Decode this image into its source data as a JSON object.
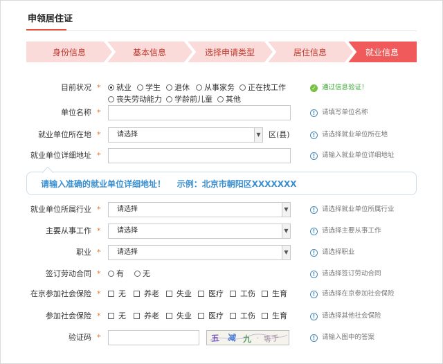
{
  "page_title": "申领居住证",
  "steps": [
    {
      "label": "身份信息",
      "active": false
    },
    {
      "label": "基本信息",
      "active": false
    },
    {
      "label": "选择申请类型",
      "active": false
    },
    {
      "label": "居住信息",
      "active": false
    },
    {
      "label": "就业信息",
      "active": true
    }
  ],
  "colors": {
    "accent": "#e84c3d",
    "step_bg": "#fbdada",
    "step_active": "#f05a5a",
    "tip_blue": "#3a8fd0"
  },
  "required_mark": "*",
  "status": {
    "label": "目前状况",
    "options": [
      "就业",
      "学生",
      "退休",
      "从事家务",
      "正在找工作",
      "丧失劳动能力",
      "学龄前儿童",
      "其他"
    ],
    "selected": "就业",
    "hint": "通过信息验证！"
  },
  "employer_name": {
    "label": "单位名称",
    "value": "",
    "hint": "请填写单位名称"
  },
  "employer_location": {
    "label": "就业单位所在地",
    "selected": "请选择",
    "suffix": "区(县)",
    "hint": "请选择就业单位所在地"
  },
  "employer_address": {
    "label": "就业单位详细地址",
    "value": "",
    "hint": "请输入就业单位详细地址"
  },
  "address_tip": "请输入准确的就业单位详细地址！    示例：北京市朝阳区XXXXXXX",
  "industry": {
    "label": "就业单位所属行业",
    "selected": "请选择",
    "hint": "请选择就业单位所属行业"
  },
  "main_work": {
    "label": "主要从事工作",
    "selected": "请选择",
    "hint": "请选择主要从事工作"
  },
  "occupation": {
    "label": "职业",
    "selected": "请选择",
    "hint": "请选择职业"
  },
  "contract": {
    "label": "签订劳动合同",
    "options": [
      "有",
      "无"
    ],
    "hint": "请选择签订劳动合同"
  },
  "beijing_insurance": {
    "label": "在京参加社会保险",
    "options": [
      "无",
      "养老",
      "失业",
      "医疗",
      "工伤",
      "生育"
    ],
    "hint": "请选择在京参加社会保险"
  },
  "other_insurance": {
    "label": "参加社会保险",
    "options": [
      "无",
      "养老",
      "失业",
      "医疗",
      "工伤",
      "生育"
    ],
    "hint": "请选择其他社会保险"
  },
  "captcha": {
    "label": "验证码",
    "value": "",
    "image_text": "五 减 九 · 等于",
    "hint": "请输入图中的答案"
  }
}
